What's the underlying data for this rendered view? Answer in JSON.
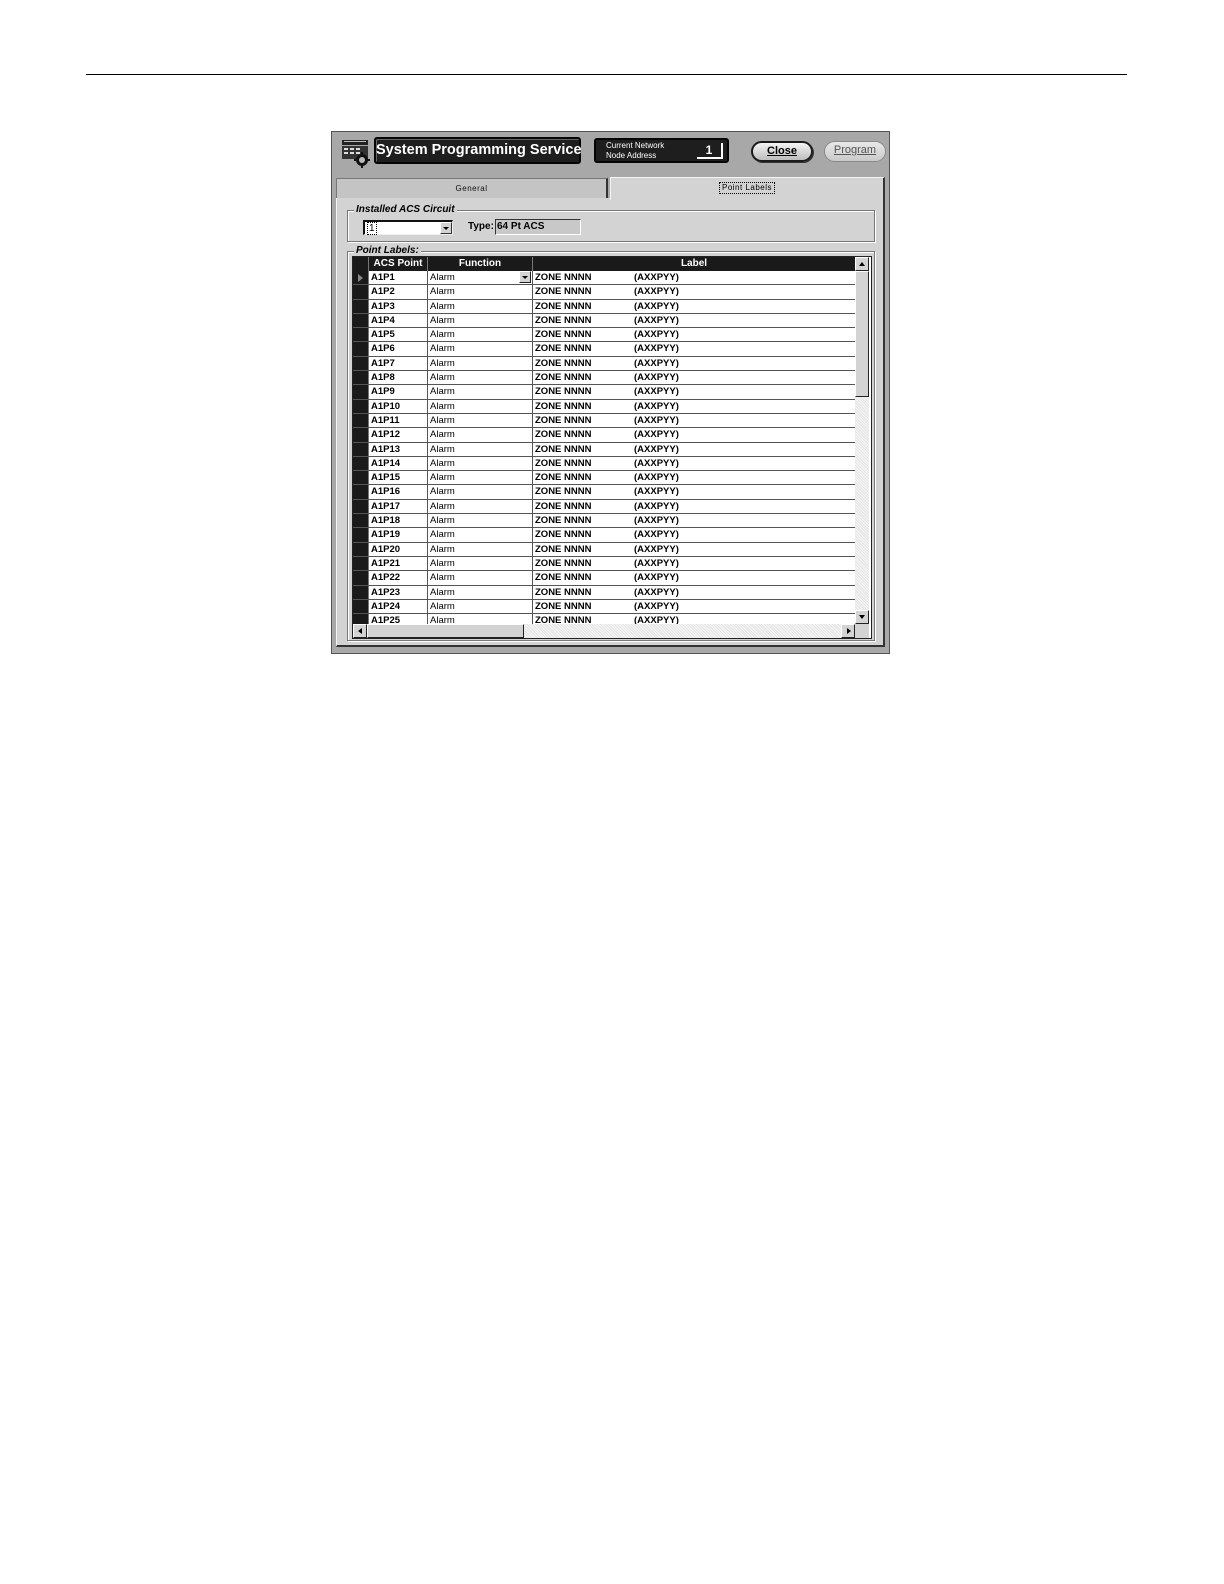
{
  "window": {
    "title": "System Programming Service",
    "node_caption_line1": "Current Network",
    "node_caption_line2": "Node Address",
    "node_address": "1",
    "close_label": "Close",
    "program_label": "Program"
  },
  "tabs": [
    {
      "label": "General",
      "active": false
    },
    {
      "label": "Point Labels",
      "active": true
    }
  ],
  "installed_circuit": {
    "group_label": "Installed ACS Circuit",
    "selected_value": "1",
    "type_label": "Type:",
    "type_value": "64 Pt ACS"
  },
  "point_labels": {
    "group_label": "Point Labels:",
    "columns": [
      "ACS Point",
      "Function",
      "Label"
    ],
    "rows": [
      {
        "point": "A1P1",
        "function": "Alarm",
        "zone": "ZONE NNNN",
        "address": "(AXXPYY)"
      },
      {
        "point": "A1P2",
        "function": "Alarm",
        "zone": "ZONE NNNN",
        "address": "(AXXPYY)"
      },
      {
        "point": "A1P3",
        "function": "Alarm",
        "zone": "ZONE NNNN",
        "address": "(AXXPYY)"
      },
      {
        "point": "A1P4",
        "function": "Alarm",
        "zone": "ZONE NNNN",
        "address": "(AXXPYY)"
      },
      {
        "point": "A1P5",
        "function": "Alarm",
        "zone": "ZONE NNNN",
        "address": "(AXXPYY)"
      },
      {
        "point": "A1P6",
        "function": "Alarm",
        "zone": "ZONE NNNN",
        "address": "(AXXPYY)"
      },
      {
        "point": "A1P7",
        "function": "Alarm",
        "zone": "ZONE NNNN",
        "address": "(AXXPYY)"
      },
      {
        "point": "A1P8",
        "function": "Alarm",
        "zone": "ZONE NNNN",
        "address": "(AXXPYY)"
      },
      {
        "point": "A1P9",
        "function": "Alarm",
        "zone": "ZONE NNNN",
        "address": "(AXXPYY)"
      },
      {
        "point": "A1P10",
        "function": "Alarm",
        "zone": "ZONE NNNN",
        "address": "(AXXPYY)"
      },
      {
        "point": "A1P11",
        "function": "Alarm",
        "zone": "ZONE NNNN",
        "address": "(AXXPYY)"
      },
      {
        "point": "A1P12",
        "function": "Alarm",
        "zone": "ZONE NNNN",
        "address": "(AXXPYY)"
      },
      {
        "point": "A1P13",
        "function": "Alarm",
        "zone": "ZONE NNNN",
        "address": "(AXXPYY)"
      },
      {
        "point": "A1P14",
        "function": "Alarm",
        "zone": "ZONE NNNN",
        "address": "(AXXPYY)"
      },
      {
        "point": "A1P15",
        "function": "Alarm",
        "zone": "ZONE NNNN",
        "address": "(AXXPYY)"
      },
      {
        "point": "A1P16",
        "function": "Alarm",
        "zone": "ZONE NNNN",
        "address": "(AXXPYY)"
      },
      {
        "point": "A1P17",
        "function": "Alarm",
        "zone": "ZONE NNNN",
        "address": "(AXXPYY)"
      },
      {
        "point": "A1P18",
        "function": "Alarm",
        "zone": "ZONE NNNN",
        "address": "(AXXPYY)"
      },
      {
        "point": "A1P19",
        "function": "Alarm",
        "zone": "ZONE NNNN",
        "address": "(AXXPYY)"
      },
      {
        "point": "A1P20",
        "function": "Alarm",
        "zone": "ZONE NNNN",
        "address": "(AXXPYY)"
      },
      {
        "point": "A1P21",
        "function": "Alarm",
        "zone": "ZONE NNNN",
        "address": "(AXXPYY)"
      },
      {
        "point": "A1P22",
        "function": "Alarm",
        "zone": "ZONE NNNN",
        "address": "(AXXPYY)"
      },
      {
        "point": "A1P23",
        "function": "Alarm",
        "zone": "ZONE NNNN",
        "address": "(AXXPYY)"
      },
      {
        "point": "A1P24",
        "function": "Alarm",
        "zone": "ZONE NNNN",
        "address": "(AXXPYY)"
      },
      {
        "point": "A1P25",
        "function": "Alarm",
        "zone": "ZONE NNNN",
        "address": "(AXXPYY)"
      }
    ]
  },
  "icons": {
    "app": "programming-panel-icon",
    "row_pointer": "row-pointer-icon",
    "dropdown": "chevron-down-icon"
  },
  "colors": {
    "window_face": "#d3d3d3",
    "title_panel": "#1e1e1e",
    "grid_header": "#1a1a1a"
  }
}
